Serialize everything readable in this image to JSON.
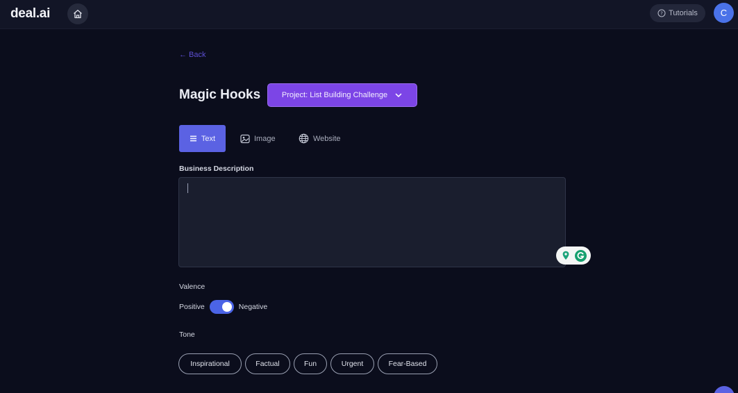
{
  "header": {
    "logo_text": "deal.ai",
    "home_icon": "home-icon",
    "tutorials_label": "Tutorials",
    "avatar_initial": "C"
  },
  "main": {
    "back_label": "← Back",
    "title": "Magic Hooks",
    "project_label": "Project: List Building Challenge",
    "tabs": [
      {
        "label": "Text",
        "icon": "list-icon",
        "active": true
      },
      {
        "label": "Image",
        "icon": "image-icon",
        "active": false
      },
      {
        "label": "Website",
        "icon": "globe-icon",
        "active": false
      }
    ],
    "business_description_label": "Business Description",
    "business_description_value": "",
    "valence": {
      "label": "Valence",
      "left_label": "Positive",
      "right_label": "Negative",
      "state": "on"
    },
    "tone": {
      "label": "Tone",
      "options": [
        "Inspirational",
        "Factual",
        "Fun",
        "Urgent",
        "Fear-Based"
      ]
    }
  },
  "colors": {
    "background": "#0b0d1c",
    "accent": "#5b62e3",
    "project_button": "#7c45e6"
  }
}
